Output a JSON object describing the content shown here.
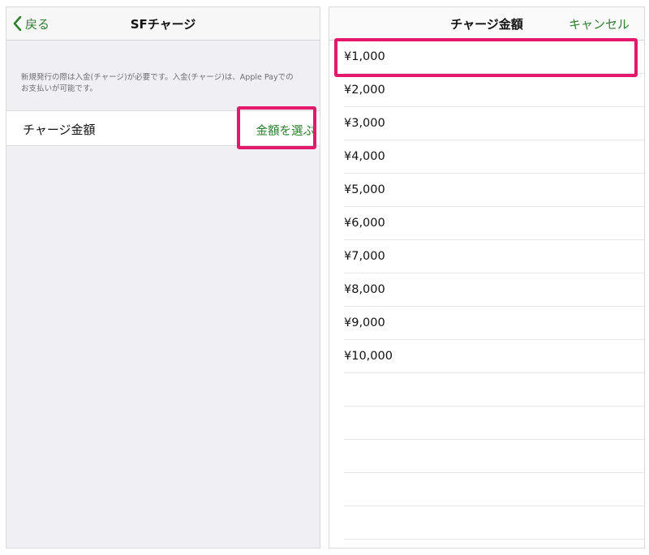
{
  "left": {
    "back_label": "戻る",
    "title": "SFチャージ",
    "note": "新規発行の際は入金(チャージ)が必要です。入金(チャージ)は、Apple Payでのお支払いが可能です。",
    "row": {
      "label": "チャージ金額",
      "action": "金額を選ぶ"
    }
  },
  "right": {
    "title": "チャージ金額",
    "cancel_label": "キャンセル",
    "amounts": [
      "¥1,000",
      "¥2,000",
      "¥3,000",
      "¥4,000",
      "¥5,000",
      "¥6,000",
      "¥7,000",
      "¥8,000",
      "¥9,000",
      "¥10,000"
    ]
  },
  "colors": {
    "accent": "#2f7f2f",
    "highlight": "#e5196b",
    "background": "#efeff4"
  }
}
